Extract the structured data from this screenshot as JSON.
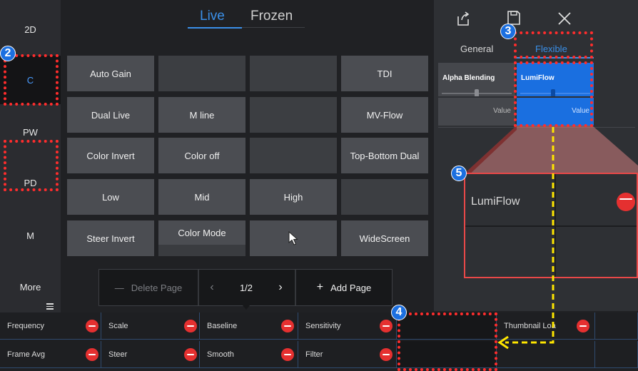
{
  "modes": [
    {
      "label": "2D",
      "selected": false
    },
    {
      "label": "C",
      "selected": true
    },
    {
      "label": "PW",
      "selected": false
    },
    {
      "label": "PD",
      "selected": false
    },
    {
      "label": "M",
      "selected": false
    },
    {
      "label": "More",
      "selected": false
    }
  ],
  "header": {
    "live": "Live",
    "frozen": "Frozen"
  },
  "grid": {
    "auto_gain": "Auto Gain",
    "tdi": "TDI",
    "dual_live": "Dual Live",
    "m_line": "M line",
    "mv_flow": "MV-Flow",
    "color_invert": "Color Invert",
    "color_off": "Color off",
    "top_bottom_dual": "Top-Bottom Dual",
    "low": "Low",
    "mid": "Mid",
    "high": "High",
    "steer_invert": "Steer Invert",
    "color_mode": "Color Mode",
    "widescreen": "WideScreen"
  },
  "pager": {
    "delete": "Delete Page",
    "delete_icon": "—",
    "prev": "‹",
    "page": "1/2",
    "next": "›",
    "add": "Add Page",
    "add_icon": "+"
  },
  "right_panel": {
    "tab_general": "General",
    "tab_flexible": "Flexible",
    "card1": {
      "title": "Alpha Blending",
      "value": "Value"
    },
    "card2": {
      "title": "LumiFlow",
      "value": "Value"
    },
    "zoom_label": "LumiFlow"
  },
  "bottom": {
    "row1": [
      "Frequency",
      "Scale",
      "Baseline",
      "Sensitivity",
      "",
      "Thumbnail Loa"
    ],
    "row2": [
      "Frame Avg",
      "Steer",
      "Smooth",
      "Filter",
      "",
      ""
    ]
  },
  "annotations": {
    "n2": "2",
    "n3": "3",
    "n4": "4",
    "n5": "5"
  },
  "colors": {
    "accent": "#1a73e8",
    "annotation": "#ff2d2d",
    "arrow": "#ffe600",
    "remove": "#e53030"
  }
}
